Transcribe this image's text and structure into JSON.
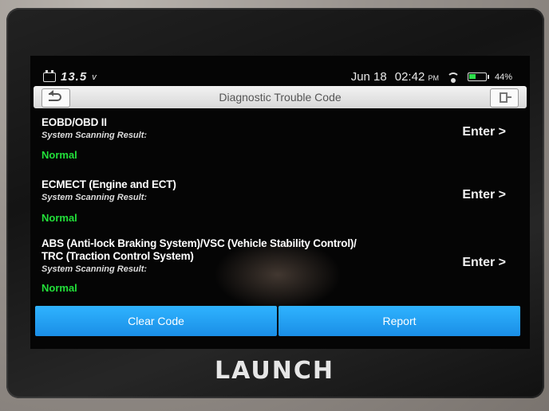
{
  "status_bar": {
    "voltage": "13.5",
    "voltage_unit": "v",
    "date": "Jun 18",
    "time": "02:42",
    "ampm": "PM",
    "battery_percent": "44%",
    "battery_level": 0.44,
    "icons": [
      "car-battery-icon",
      "wifi-icon",
      "battery-icon"
    ]
  },
  "header": {
    "title": "Diagnostic Trouble Code",
    "back_icon": "back-icon",
    "exit_icon": "exit-icon"
  },
  "systems": [
    {
      "name_line1": "EOBD/OBD II",
      "name_line2": "",
      "subtitle": "System Scanning Result:",
      "status": "Normal",
      "action": "Enter >"
    },
    {
      "name_line1": "ECMECT (Engine and ECT)",
      "name_line2": "",
      "subtitle": "System Scanning Result:",
      "status": "Normal",
      "action": "Enter >"
    },
    {
      "name_line1": "ABS (Anti-lock Braking System)/VSC (Vehicle Stability Control)/",
      "name_line2": "TRC (Traction Control System)",
      "subtitle": "System Scanning Result:",
      "status": "Normal",
      "action": "Enter >"
    }
  ],
  "footer": {
    "clear_label": "Clear Code",
    "report_label": "Report"
  },
  "device": {
    "brand": "LAUNCH"
  },
  "colors": {
    "accent": "#1a9af0",
    "status_ok": "#22e03a",
    "screen_bg": "#050505"
  }
}
